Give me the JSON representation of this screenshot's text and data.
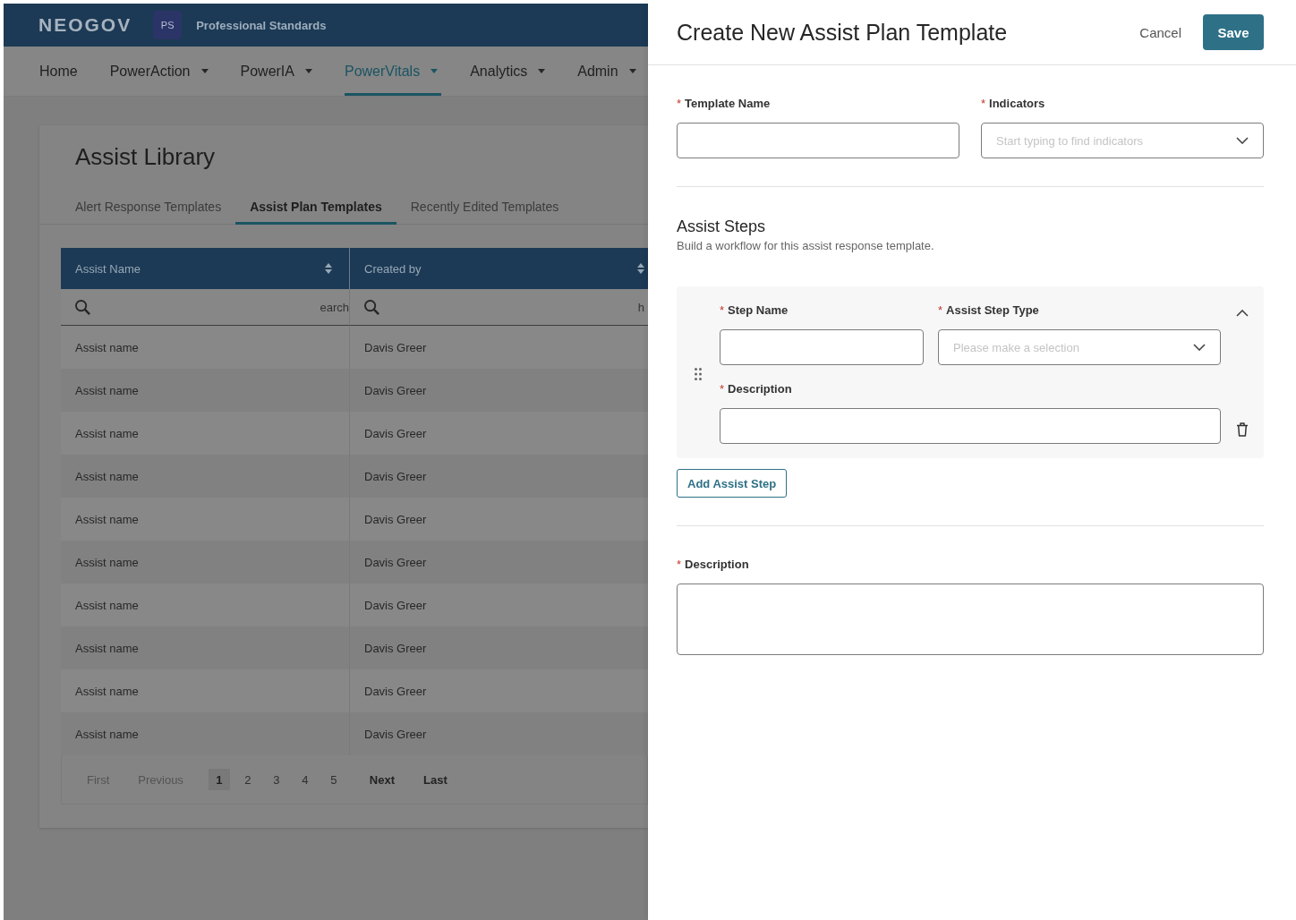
{
  "header": {
    "logo": "NEOGOV",
    "badge": "PS",
    "product": "Professional Standards"
  },
  "nav": [
    {
      "label": "Home",
      "has_menu": false,
      "selected": false
    },
    {
      "label": "PowerAction",
      "has_menu": true,
      "selected": false
    },
    {
      "label": "PowerIA",
      "has_menu": true,
      "selected": false
    },
    {
      "label": "PowerVitals",
      "has_menu": true,
      "selected": true
    },
    {
      "label": "Analytics",
      "has_menu": true,
      "selected": false
    },
    {
      "label": "Admin",
      "has_menu": true,
      "selected": false
    }
  ],
  "library": {
    "title": "Assist Library",
    "tabs": [
      {
        "label": "Alert Response Templates",
        "selected": false
      },
      {
        "label": "Assist Plan Templates",
        "selected": true
      },
      {
        "label": "Recently Edited Templates",
        "selected": false
      }
    ]
  },
  "table": {
    "columns": [
      {
        "label": "Assist Name",
        "sortable": true,
        "search": {
          "placeholder": "earch"
        }
      },
      {
        "label": "Created by",
        "sortable": true,
        "search": {
          "placeholder": "h"
        }
      }
    ],
    "rows": [
      [
        "Assist name",
        "Davis Greer"
      ],
      [
        "Assist name",
        "Davis Greer"
      ],
      [
        "Assist name",
        "Davis Greer"
      ],
      [
        "Assist name",
        "Davis Greer"
      ],
      [
        "Assist name",
        "Davis Greer"
      ],
      [
        "Assist name",
        "Davis Greer"
      ],
      [
        "Assist name",
        "Davis Greer"
      ],
      [
        "Assist name",
        "Davis Greer"
      ],
      [
        "Assist name",
        "Davis Greer"
      ],
      [
        "Assist name",
        "Davis Greer"
      ]
    ]
  },
  "pagination": {
    "controls_before": [
      {
        "label": "First",
        "disabled": true
      },
      {
        "label": "Previous",
        "disabled": true
      }
    ],
    "pages": [
      {
        "label": "1",
        "selected": true
      },
      {
        "label": "2",
        "selected": false
      },
      {
        "label": "3",
        "selected": false
      },
      {
        "label": "4",
        "selected": false
      },
      {
        "label": "5",
        "selected": false
      }
    ],
    "controls_after": [
      {
        "label": "Next",
        "disabled": false
      },
      {
        "label": "Last",
        "disabled": false
      }
    ]
  },
  "panel": {
    "title": "Create New Assist Plan Template",
    "actions": [
      {
        "label": "Cancel",
        "kind": "text"
      },
      {
        "label": "Save",
        "kind": "primary"
      }
    ],
    "fields": [
      {
        "label": "Template Name",
        "required_mark": "*",
        "kind": "text"
      },
      {
        "label": "Indicators",
        "required_mark": "*",
        "kind": "select",
        "placeholder": "Start typing to find indicators"
      }
    ],
    "steps_section": {
      "title": "Assist Steps",
      "subtitle": "Build a workflow for this assist response template.",
      "steps": [
        {
          "expanded": true,
          "fields": [
            {
              "label": "Step Name",
              "required_mark": "*",
              "kind": "text"
            },
            {
              "label": "Assist Step Type",
              "required_mark": "*",
              "kind": "select",
              "placeholder": "Please make a selection"
            },
            {
              "label": "Description",
              "required_mark": "*",
              "kind": "text"
            }
          ]
        }
      ],
      "add_button": "Add Assist Step"
    },
    "description": {
      "label": "Description",
      "required_mark": "*",
      "kind": "textarea"
    }
  }
}
